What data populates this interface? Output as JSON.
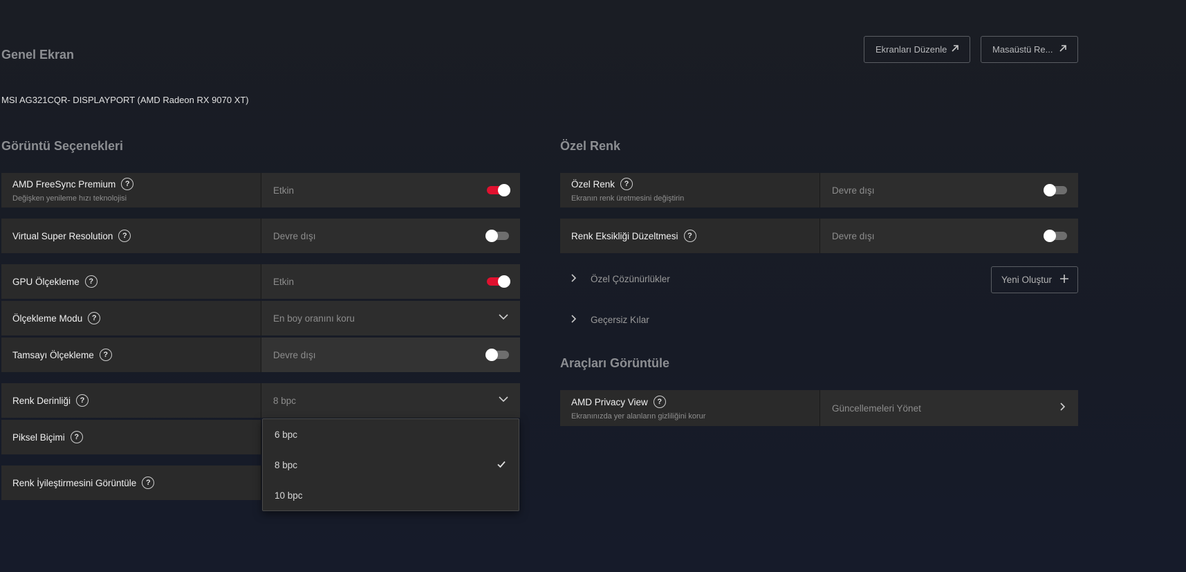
{
  "header": {
    "title": "Genel Ekran",
    "edit_displays": "Ekranları Düzenle",
    "desktop": "Masaüstü Re...",
    "monitor": "MSI AG321CQR- DISPLAYPORT (AMD Radeon RX 9070 XT)"
  },
  "display_options": {
    "title": "Görüntü Seçenekleri",
    "freesync": {
      "label": "AMD FreeSync Premium",
      "sub": "Değişken yenileme hızı teknolojisi",
      "value": "Etkin",
      "on": true
    },
    "vsr": {
      "label": "Virtual Super Resolution",
      "value": "Devre dışı",
      "on": false
    },
    "gpu_scaling": {
      "label": "GPU Ölçekleme",
      "value": "Etkin",
      "on": true
    },
    "scaling_mode": {
      "label": "Ölçekleme Modu",
      "value": "En boy oranını koru"
    },
    "integer_scaling": {
      "label": "Tamsayı Ölçekleme",
      "value": "Devre dışı",
      "on": false
    },
    "color_depth": {
      "label": "Renk Derinliği",
      "value": "8 bpc",
      "options": [
        "6 bpc",
        "8 bpc",
        "10 bpc"
      ],
      "selected": "8 bpc"
    },
    "pixel_format": {
      "label": "Piksel Biçimi"
    },
    "color_enhance": {
      "label": "Renk İyileştirmesini Görüntüle"
    }
  },
  "custom_color": {
    "title": "Özel Renk",
    "custom": {
      "label": "Özel Renk",
      "sub": "Ekranın renk üretmesini değiştirin",
      "value": "Devre dışı",
      "on": false
    },
    "deficiency": {
      "label": "Renk Eksikliği Düzeltmesi",
      "value": "Devre dışı",
      "on": false
    },
    "custom_res": "Özel Çözünürlükler",
    "new_create": "Yeni Oluştur",
    "override": "Geçersiz Kılar"
  },
  "tools": {
    "title": "Araçları Görüntüle",
    "privacy": {
      "label": "AMD Privacy View",
      "sub": "Ekranınızda yer alanların gizliliğini korur",
      "value": "Güncellemeleri Yönet"
    }
  },
  "colors": {
    "accent": "#e1112f"
  }
}
